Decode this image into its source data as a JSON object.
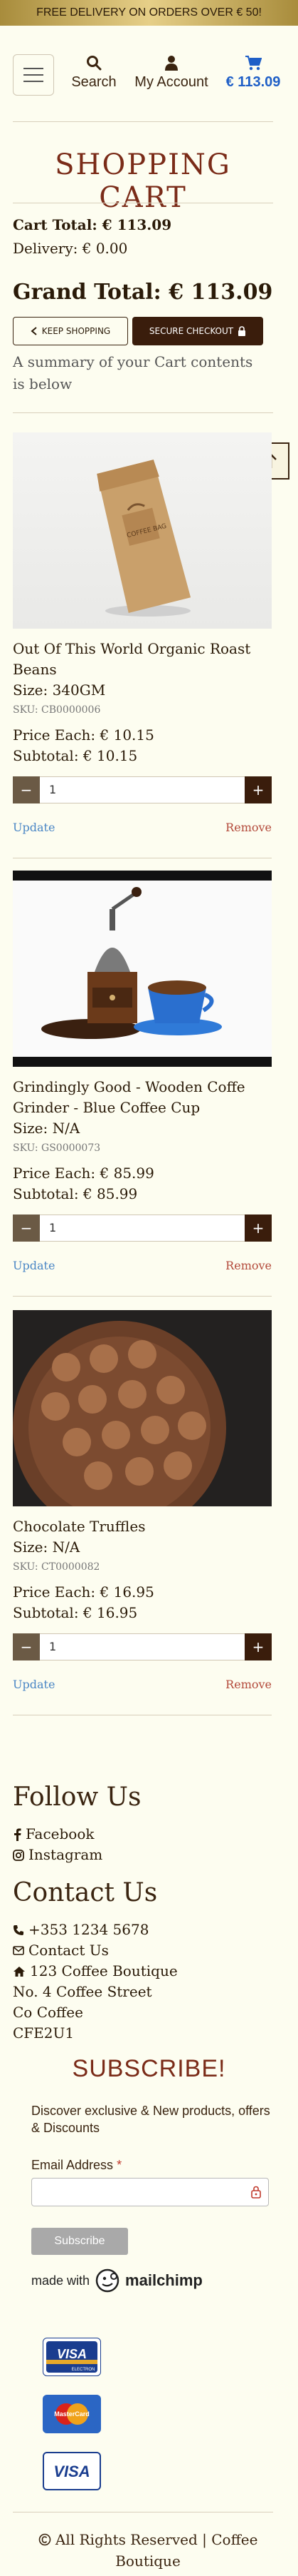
{
  "banner": {
    "text": "FREE DELIVERY ON ORDERS OVER € 50!"
  },
  "header": {
    "menu_icon": "hamburger-icon",
    "search": {
      "label": "Search",
      "icon": "search-icon"
    },
    "account": {
      "label": "My Account",
      "icon": "user-icon"
    },
    "cart": {
      "label": "€ 113.09",
      "icon": "cart-icon"
    }
  },
  "cart": {
    "title": "SHOPPING CART",
    "cart_total": "Cart Total: € 113.09",
    "delivery": "Delivery: € 0.00",
    "grand_total": "Grand Total: € 113.09",
    "keep_shopping": "KEEP SHOPPING",
    "secure_checkout": "SECURE CHECKOUT",
    "summary": "A summary of your Cart contents is below"
  },
  "items": [
    {
      "name": "Out Of This World Organic Roast Beans",
      "size": "Size: 340GM",
      "sku": "SKU: CB0000006",
      "price": "Price Each: € 10.15",
      "subtotal": "Subtotal: € 10.15",
      "qty": "1",
      "update": "Update",
      "remove": "Remove",
      "bag_label": "COFFEE BAG"
    },
    {
      "name": "Grindingly Good - Wooden Coffe Grinder - Blue Coffee Cup",
      "size": "Size: N/A",
      "sku": "SKU: GS0000073",
      "price": "Price Each: € 85.99",
      "subtotal": "Subtotal: € 85.99",
      "qty": "1",
      "update": "Update",
      "remove": "Remove"
    },
    {
      "name": "Chocolate Truffles",
      "size": "Size: N/A",
      "sku": "SKU: CT0000082",
      "price": "Price Each: € 16.95",
      "subtotal": "Subtotal: € 16.95",
      "qty": "1",
      "update": "Update",
      "remove": "Remove"
    }
  ],
  "footer": {
    "follow_heading": "Follow Us",
    "facebook": "Facebook",
    "instagram": "Instagram",
    "contact_heading": "Contact Us",
    "phone": "+353 1234 5678",
    "contact_link": "Contact Us",
    "address_line1": "123 Coffee Boutique",
    "address_line2": "No. 4 Coffee Street",
    "address_line3": "Co Coffee",
    "address_line4": "CFE2U1"
  },
  "newsletter": {
    "title": "SUBSCRIBE!",
    "text": "Discover exclusive & New products, offers & Discounts",
    "email_label": "Email Address",
    "required_mark": "*",
    "button": "Subscribe",
    "made_with": "made with",
    "brand": "mailchimp"
  },
  "payments": {
    "visa_electron": "VISA",
    "visa_electron_sub": "ELECTRON",
    "mastercard": "MasterCard",
    "visa": "VISA"
  },
  "copyright": "All Rights Reserved | Coffee Boutique",
  "colors": {
    "accent": "#7a2b18",
    "dark_brown": "#3a1d0c",
    "cart_blue": "#1f5fc7",
    "background": "#fdfdf0"
  }
}
